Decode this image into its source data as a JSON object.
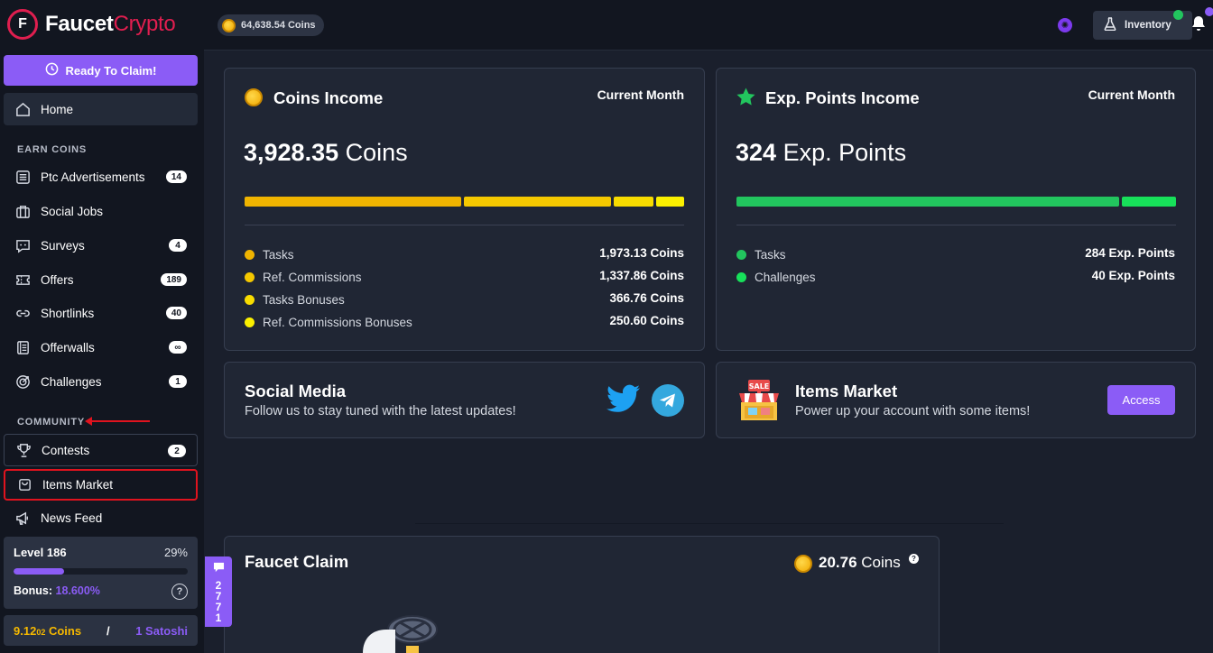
{
  "brand": {
    "name_white": "Faucet",
    "name_red": "Crypto",
    "mark": "F"
  },
  "sidebar": {
    "claim_button": "Ready To Claim!",
    "home": "Home",
    "earn_section": "EARN COINS",
    "earn_items": [
      {
        "label": "Ptc Advertisements",
        "badge": "14",
        "icon": "list-icon"
      },
      {
        "label": "Social Jobs",
        "badge": "",
        "icon": "briefcase-icon"
      },
      {
        "label": "Surveys",
        "badge": "4",
        "icon": "survey-chat-icon"
      },
      {
        "label": "Offers",
        "badge": "189",
        "icon": "ticket-icon"
      },
      {
        "label": "Shortlinks",
        "badge": "40",
        "icon": "link-icon"
      },
      {
        "label": "Offerwalls",
        "badge": "∞",
        "icon": "document-icon"
      },
      {
        "label": "Challenges",
        "badge": "1",
        "icon": "target-icon"
      }
    ],
    "community_section": "COMMUNITY",
    "community_items": [
      {
        "label": "Contests",
        "badge": "2",
        "icon": "trophy-icon"
      },
      {
        "label": "Items Market",
        "badge": "",
        "icon": "shopping-bag-icon"
      },
      {
        "label": "News Feed",
        "badge": "",
        "icon": "megaphone-icon"
      }
    ],
    "level": {
      "title": "Level 186",
      "percent_text": "29%",
      "progress": 0.29,
      "bonus_label": "Bonus:",
      "bonus_value": "18.600%"
    },
    "balance": {
      "coins_main": "9.12",
      "coins_small": "02",
      "coins_unit": " Coins",
      "separator": "/",
      "satoshi": "1 Satoshi"
    }
  },
  "topbar": {
    "coins_balance": "64,638.54 Coins",
    "inventory_label": "Inventory"
  },
  "coins_income": {
    "title": "Coins Income",
    "period": "Current Month",
    "total_number": "3,928.35",
    "total_unit": "Coins",
    "rows": [
      {
        "label": "Tasks",
        "value": "1,973.13 Coins",
        "color": "#f0b400",
        "amount": 1973.13
      },
      {
        "label": "Ref. Commissions",
        "value": "1,337.86 Coins",
        "color": "#f5c800",
        "amount": 1337.86
      },
      {
        "label": "Tasks Bonuses",
        "value": "366.76 Coins",
        "color": "#f8dc00",
        "amount": 366.76
      },
      {
        "label": "Ref. Commissions Bonuses",
        "value": "250.60 Coins",
        "color": "#fbf000",
        "amount": 250.6
      }
    ]
  },
  "exp_income": {
    "title": "Exp. Points Income",
    "period": "Current Month",
    "total_number": "324",
    "total_unit": "Exp. Points",
    "rows": [
      {
        "label": "Tasks",
        "value": "284 Exp. Points",
        "color": "#22c55e",
        "amount": 284
      },
      {
        "label": "Challenges",
        "value": "40 Exp. Points",
        "color": "#17e05a",
        "amount": 40
      }
    ]
  },
  "social_media": {
    "title": "Social Media",
    "subtitle": "Follow us to stay tuned with the latest updates!"
  },
  "items_market": {
    "title": "Items Market",
    "subtitle": "Power up your account with some items!",
    "button": "Access",
    "sign": "SALE"
  },
  "faucet_claim": {
    "title": "Faucet Claim",
    "reward": "20.76",
    "reward_unit": "Coins",
    "help": "?"
  },
  "chat_tab": {
    "count_digits": [
      "2",
      "7",
      "7",
      "1"
    ]
  }
}
